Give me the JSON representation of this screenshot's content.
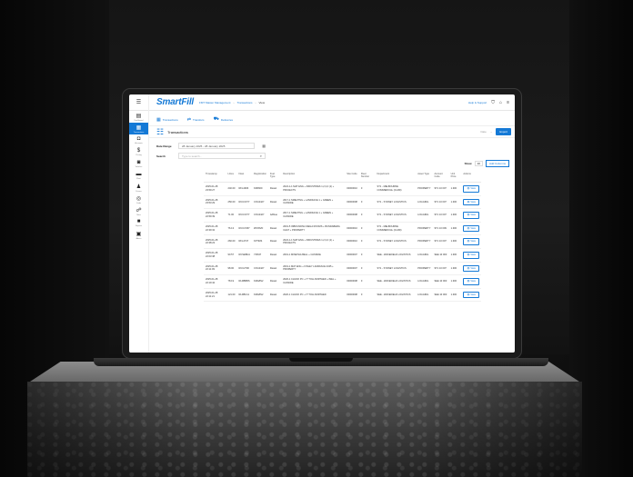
{
  "app": {
    "brand": "SmartFill",
    "breadcrumbs": [
      "FMT Master Management",
      "Transactions",
      "View"
    ],
    "help_label": "Help & Support"
  },
  "sidebar": {
    "items": [
      {
        "icon": "home-icon",
        "glyph": "▤",
        "label": "Dashboard"
      },
      {
        "icon": "list-icon",
        "glyph": "▦",
        "label": "Transactions",
        "active": true
      },
      {
        "icon": "fuel-icon",
        "glyph": "⛽",
        "label": "Accounts"
      },
      {
        "icon": "dollar-icon",
        "glyph": "$",
        "label": "Pricing"
      },
      {
        "icon": "car-icon",
        "glyph": "🚘",
        "label": "Vehicles"
      },
      {
        "icon": "truck-icon",
        "glyph": "⛟",
        "label": "Fleet"
      },
      {
        "icon": "users-icon",
        "glyph": "👥",
        "label": "Drivers"
      },
      {
        "icon": "card-icon",
        "glyph": "💳",
        "label": "Cards"
      },
      {
        "icon": "network-icon",
        "glyph": "⚙",
        "label": "Sites"
      },
      {
        "icon": "grid-icon",
        "glyph": "◼",
        "label": "Reports"
      },
      {
        "icon": "box-icon",
        "glyph": "▣",
        "label": "Admin"
      }
    ]
  },
  "tabs": [
    {
      "icon": "list-icon",
      "label": "Transactions"
    },
    {
      "icon": "transfer-icon",
      "label": "Transfers"
    },
    {
      "icon": "deliveries-icon",
      "label": "Deliveries"
    }
  ],
  "page": {
    "title": "Transactions",
    "export_label": "Export",
    "filter_label": "Date"
  },
  "filters": {
    "date_range_label": "Date Range",
    "date_range_value": "28 January 2025 - 28 January 2025",
    "search_label": "Search",
    "search_placeholder": "Type to search..."
  },
  "show": {
    "label": "Show",
    "value": "10",
    "add_columns_label": "Add Columns"
  },
  "table": {
    "columns": [
      "Timestamp",
      "Litres",
      "Fleet",
      "Registration",
      "Fuel Type",
      "Description",
      "Site Code",
      "Fleet Number",
      "Department",
      "Asset Type",
      "Account Code",
      "Unit Price",
      "Actions"
    ],
    "rows": [
      [
        "2025-01-28 23:59:27",
        "240.00",
        "RFL4906",
        "KR6609",
        "Diesel",
        "2024-1-1 MAT ENG + INDUSTRIES 1,2,3,4 (1) + PROJECTS",
        "00000010",
        "0",
        "ST1 - MELBOURNE COMMERCIAL (CLRD)",
        "PROPERTY",
        "ST1 10 007",
        "1.300",
        "View"
      ],
      [
        "2025-01-28 23:53:29",
        "250.00",
        "RCCCF77",
        "CXG3427",
        "Diesel",
        "2017-1 SMELTING + LANDFACE 1 + GREEN + CASSIDE",
        "00000008",
        "0",
        "ST1 - SYDNEY LOGISTICS",
        "LOGGING",
        "ST1 10 007",
        "1.300",
        "View"
      ],
      [
        "2025-01-28 22:59:39",
        "71.00",
        "RCCCF77",
        "CXG3427",
        "Adblue",
        "2017-1 SMELTING + LANDFACE 1 + GREEN + CASSIDE",
        "00000008",
        "0",
        "ST1 - SYDNEY LOGISTICS",
        "LOGGING",
        "ST1 10 007",
        "1.300",
        "View"
      ],
      [
        "2025-01-28 22:39:32",
        "76.13",
        "RCCCS57",
        "ZP2NVD",
        "Diesel",
        "2019-5 INBOUNDSG MEGA ROOMS + BUNDABERG CHAT + PROPERTY",
        "00000010",
        "0",
        "ST1 - MELBOURNE COMMERCIAL (CLRD)",
        "PROPERTY",
        "ST1 10 009",
        "1.300",
        "View"
      ],
      [
        "2025-01-28 22:38:23",
        "260.00",
        "RFL4747",
        "KP7484",
        "Diesel",
        "2024-1-1 MAT ENG + INDUSTRIES 1,2,3,4 (1) + PROJECTS",
        "00000010",
        "0",
        "ST1 - SYDNEY LOGISTICS",
        "PROPERTY",
        "ST1 10 007",
        "1.300",
        "View"
      ],
      [
        "2025-01-28 22:03:38",
        "90.57",
        "RCSEBCA",
        "YRS37",
        "Diesel",
        "2019-1 MINETHA BELL + CASSIDE",
        "00000007",
        "0",
        "SEE - WAKEFIELD LOGISTICS",
        "LOGGING",
        "SEE 10 003",
        "1.300",
        "View"
      ],
      [
        "2025-01-28 22:11:09",
        "98.00",
        "RCC2700",
        "CXG3427",
        "Diesel",
        "2019-1 MAT ENG + FINLEY LANDFACE 2345 + PROPERTY",
        "00000007",
        "0",
        "ST1 - SYDNEY LOGISTICS",
        "PROPERTY",
        "ST1 10 007",
        "1.300",
        "View"
      ],
      [
        "2025-01-28 22:19:42",
        "78.19",
        "RLDBBBS",
        "KMA8N2",
        "Diesel",
        "2020-1 CHUCK PC + IT TOLLNORTHED + INEL + CASSIDE",
        "00000008",
        "0",
        "SEE - WAKEFIELD LOGISTICS",
        "LOGGING",
        "SEE 10 003",
        "1.300",
        "View"
      ],
      [
        "2025-01-28 22:11:21",
        "121.00",
        "RLDBC11",
        "KMA8N2",
        "Diesel",
        "2020-1 CHUCK PC + IT TOLLNORTHED",
        "00000008",
        "0",
        "SEE - WAKEFIELD LOGISTICS",
        "LOGGING",
        "SEE 10 003",
        "1.300",
        "View"
      ]
    ]
  }
}
